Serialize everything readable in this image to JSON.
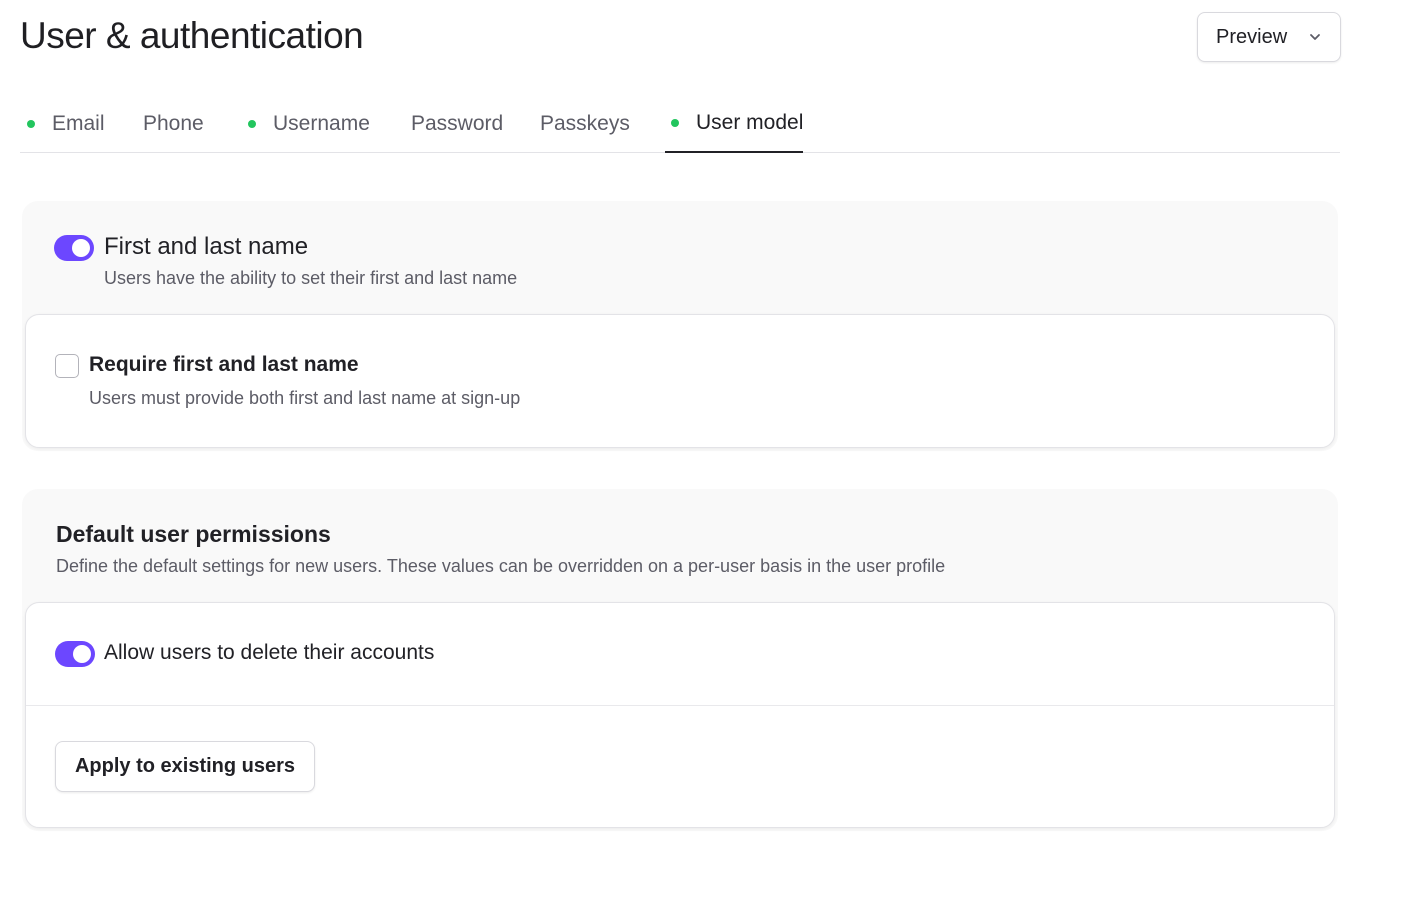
{
  "header": {
    "title": "User & authentication",
    "preview_label": "Preview"
  },
  "tabs": [
    {
      "label": "Email",
      "enabled": true,
      "active": false
    },
    {
      "label": "Phone",
      "enabled": false,
      "active": false
    },
    {
      "label": "Username",
      "enabled": true,
      "active": false
    },
    {
      "label": "Password",
      "enabled": false,
      "active": false
    },
    {
      "label": "Passkeys",
      "enabled": false,
      "active": false
    },
    {
      "label": "User model",
      "enabled": true,
      "active": true
    }
  ],
  "name_section": {
    "toggle_on": true,
    "title": "First and last name",
    "description": "Users have the ability to set their first and last name",
    "require": {
      "checked": false,
      "label": "Require first and last name",
      "description": "Users must provide both first and last name at sign-up"
    }
  },
  "permissions_section": {
    "title": "Default user permissions",
    "description": "Define the default settings for new users. These values can be overridden on a per-user basis in the user profile",
    "delete_accounts": {
      "toggle_on": true,
      "label": "Allow users to delete their accounts"
    },
    "apply_label": "Apply to existing users"
  },
  "colors": {
    "accent": "#6c47ff",
    "enabled_dot": "#22c55e"
  }
}
